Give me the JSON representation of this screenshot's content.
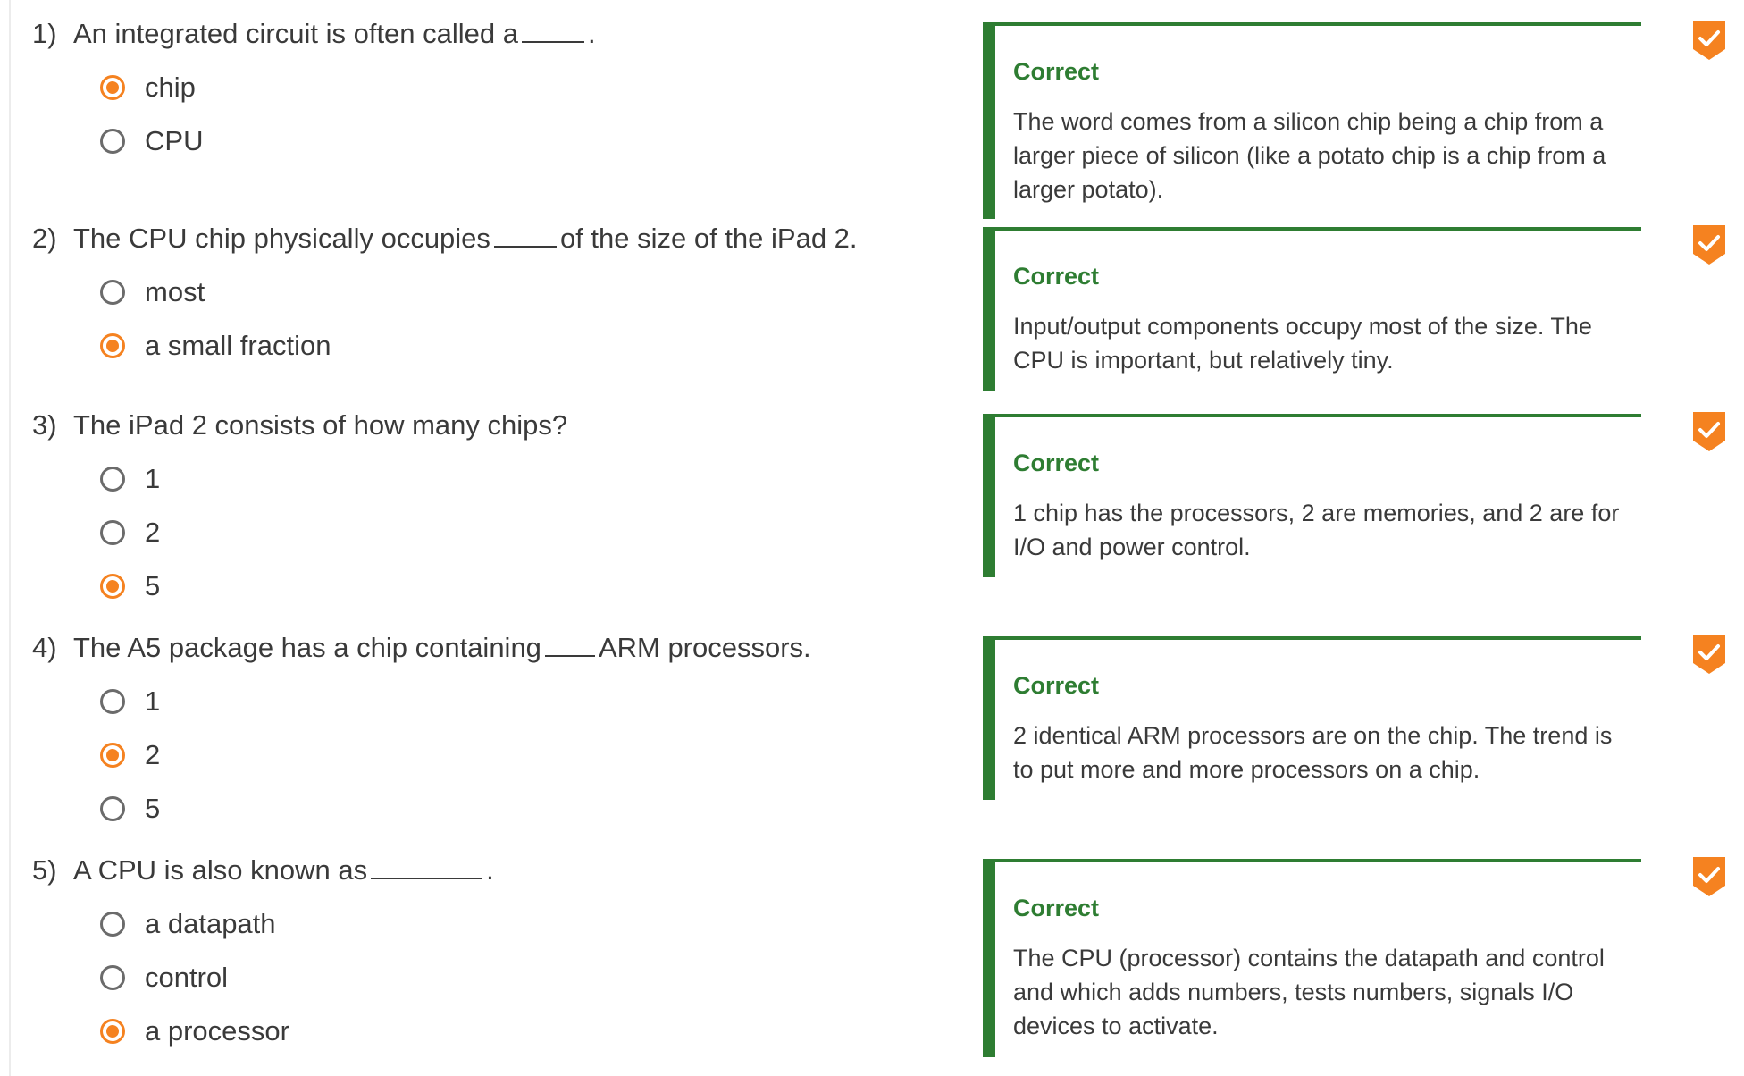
{
  "questions": [
    {
      "number": "1)",
      "prompt_before": "An integrated circuit is often called a",
      "prompt_after": ".",
      "options": [
        {
          "label": "chip",
          "checked": true
        },
        {
          "label": "CPU",
          "checked": false
        }
      ],
      "feedback": {
        "title": "Correct",
        "text": "The word comes from a silicon chip being a chip from a larger piece of silicon (like a potato chip is a chip from a larger potato)."
      }
    },
    {
      "number": "2)",
      "prompt_before": "The CPU chip physically occupies",
      "prompt_after": "of the size of the iPad 2.",
      "options": [
        {
          "label": "most",
          "checked": false
        },
        {
          "label": "a small fraction",
          "checked": true
        }
      ],
      "feedback": {
        "title": "Correct",
        "text": "Input/output components occupy most of the size. The CPU is important, but relatively tiny."
      }
    },
    {
      "number": "3)",
      "prompt_before": "The iPad 2 consists of how many chips?",
      "prompt_after": "",
      "options": [
        {
          "label": "1",
          "checked": false
        },
        {
          "label": "2",
          "checked": false
        },
        {
          "label": "5",
          "checked": true
        }
      ],
      "feedback": {
        "title": "Correct",
        "text": "1 chip has the processors, 2 are memories, and 2 are for I/O and power control."
      }
    },
    {
      "number": "4)",
      "prompt_before": "The A5 package has a chip containing",
      "prompt_after": "ARM processors.",
      "options": [
        {
          "label": "1",
          "checked": false
        },
        {
          "label": "2",
          "checked": true
        },
        {
          "label": "5",
          "checked": false
        }
      ],
      "feedback": {
        "title": "Correct",
        "text": "2 identical ARM processors are on the chip. The trend is to put more and more processors on a chip."
      }
    },
    {
      "number": "5)",
      "prompt_before": "A CPU is also known as",
      "prompt_after": ".",
      "options": [
        {
          "label": "a datapath",
          "checked": false
        },
        {
          "label": "control",
          "checked": false
        },
        {
          "label": "a processor",
          "checked": true
        }
      ],
      "feedback": {
        "title": "Correct",
        "text": "The CPU (processor) contains the datapath and control and which adds numbers, tests numbers, signals I/O devices to activate."
      }
    }
  ],
  "colors": {
    "selected": "#f58220",
    "correct": "#2e7d32",
    "badge": "#f58220"
  },
  "icons": {
    "badge": "checkmark-badge-icon",
    "radio_on": "radio-selected-icon",
    "radio_off": "radio-unselected-icon"
  }
}
